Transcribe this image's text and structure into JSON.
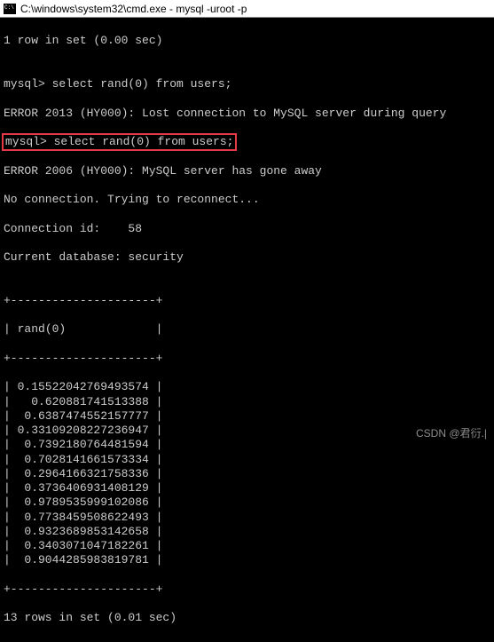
{
  "titlebar": {
    "text": "C:\\windows\\system32\\cmd.exe - mysql  -uroot -p"
  },
  "lines": {
    "row_info_top": "1 row in set (0.00 sec)",
    "blank": "",
    "prompt1": "mysql> select rand(0) from users;",
    "err2013": "ERROR 2013 (HY000): Lost connection to MySQL server during query",
    "prompt2": "mysql> select rand(0) from users;",
    "err2006": "ERROR 2006 (HY000): MySQL server has gone away",
    "noconn": "No connection. Trying to reconnect...",
    "connid": "Connection id:    58",
    "curdb": "Current database: security",
    "col_header": " rand(0)             ",
    "border": "+---------------------+"
  },
  "result_values": [
    "0.15522042769493574",
    "0.620881741513388",
    "0.6387474552157777",
    "0.33109208227236947",
    "0.7392180764481594",
    "0.7028141661573334",
    "0.2964166321758336",
    "0.3736406931408129",
    "0.9789535999102086",
    "0.7738459508622493",
    "0.9323689853142658",
    "0.3403071047182261",
    "0.9044285983819781"
  ],
  "footer": "13 rows in set (0.01 sec)",
  "watermark": "CSDN @君衍.|"
}
